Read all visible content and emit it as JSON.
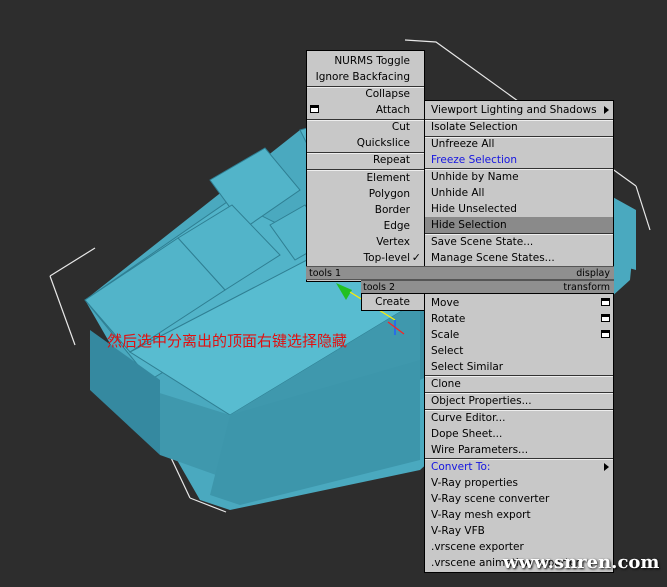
{
  "caption": "然后选中分离出的顶面右键选择隐藏",
  "watermark": "www.snren.com",
  "colors": {
    "model": "#4aa9bf",
    "menu_bg": "#c8c8c8",
    "highlight": "#8a8a8a",
    "caption": "#e01010"
  },
  "left_menu": {
    "items": [
      {
        "label": "NURMS Toggle"
      },
      {
        "label": "Ignore Backfacing"
      },
      {
        "label": "Collapse"
      },
      {
        "label": "Attach",
        "icon": "settings-box-icon"
      },
      {
        "label": "Cut"
      },
      {
        "label": "Quickslice"
      },
      {
        "label": "Repeat"
      },
      {
        "label": "Element"
      },
      {
        "label": "Polygon"
      },
      {
        "label": "Border"
      },
      {
        "label": "Edge"
      },
      {
        "label": "Vertex"
      },
      {
        "label": "Top-level",
        "checked": true
      }
    ],
    "header_left": "tools 1",
    "header2_left": "tools 2",
    "create": "Create"
  },
  "right_menu": {
    "header_right": "display",
    "header2_right": "transform",
    "display_items": [
      {
        "label": "Viewport Lighting and Shadows",
        "submenu": true
      },
      {
        "label": "Isolate Selection"
      },
      {
        "label": "Unfreeze All"
      },
      {
        "label": "Freeze Selection",
        "blue": true
      },
      {
        "label": "Unhide by Name"
      },
      {
        "label": "Unhide All"
      },
      {
        "label": "Hide Unselected"
      },
      {
        "label": "Hide Selection",
        "highlighted": true
      },
      {
        "label": "Save Scene State..."
      },
      {
        "label": "Manage Scene States..."
      }
    ],
    "transform_items": [
      {
        "label": "Move",
        "icon": "settings-box-icon"
      },
      {
        "label": "Rotate",
        "icon": "settings-box-icon"
      },
      {
        "label": "Scale",
        "icon": "settings-box-icon"
      },
      {
        "label": "Select"
      },
      {
        "label": "Select Similar"
      },
      {
        "label": "Clone"
      },
      {
        "label": "Object Properties..."
      },
      {
        "label": "Curve Editor..."
      },
      {
        "label": "Dope Sheet..."
      },
      {
        "label": "Wire Parameters..."
      },
      {
        "label": "Convert To:",
        "blue": true,
        "submenu": true
      },
      {
        "label": "V-Ray properties"
      },
      {
        "label": "V-Ray scene converter"
      },
      {
        "label": "V-Ray mesh export"
      },
      {
        "label": "V-Ray VFB"
      },
      {
        "label": ".vrscene exporter"
      },
      {
        "label": ".vrscene animation exporter"
      }
    ]
  }
}
